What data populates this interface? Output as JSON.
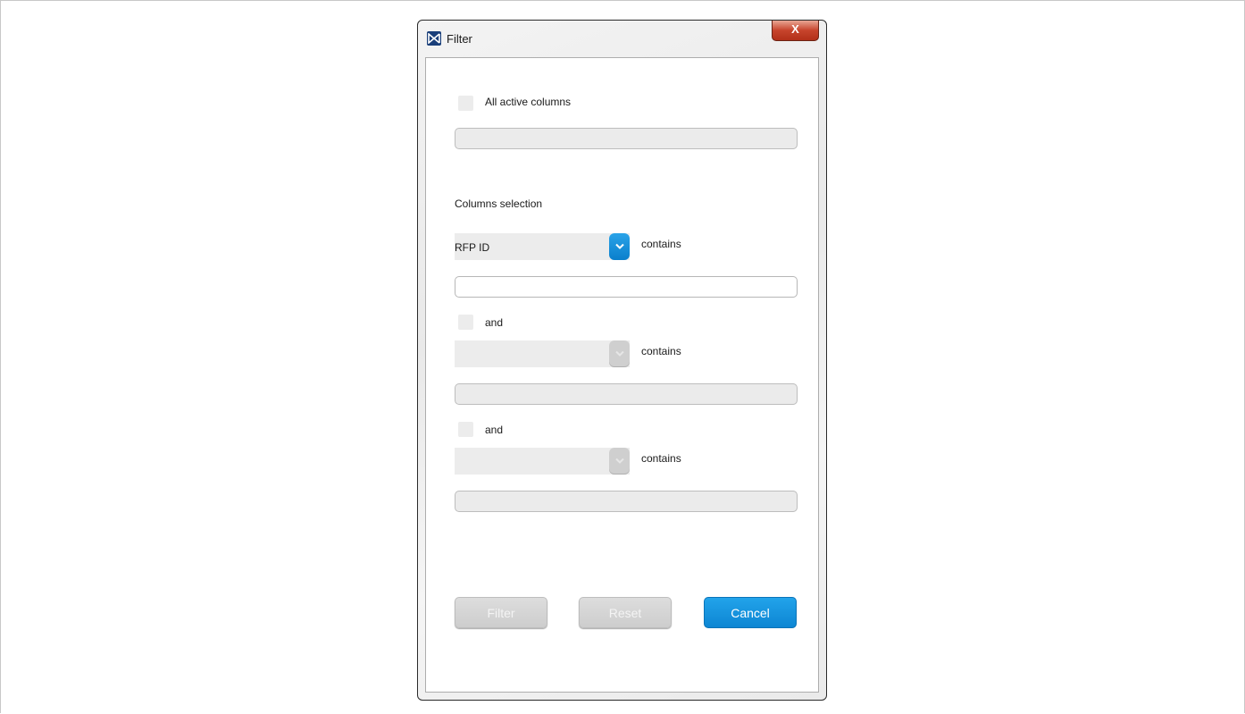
{
  "window": {
    "title": "Filter",
    "close_label": "X"
  },
  "all_active": {
    "label": "All active columns"
  },
  "columns_selection": {
    "label": "Columns selection"
  },
  "rows": [
    {
      "selected": "RFP ID",
      "operator": "contains",
      "value": ""
    },
    {
      "joiner": "and",
      "selected": "",
      "operator": "contains",
      "value": ""
    },
    {
      "joiner": "and",
      "selected": "",
      "operator": "contains",
      "value": ""
    }
  ],
  "buttons": {
    "filter": "Filter",
    "reset": "Reset",
    "cancel": "Cancel"
  },
  "colors": {
    "accent": "#0d86d3",
    "close": "#c7442c",
    "disabled": "#cdcdcd"
  },
  "icons": {
    "app": "app-logo-icon",
    "dropdown": "chevron-down-icon",
    "close": "close-icon"
  }
}
